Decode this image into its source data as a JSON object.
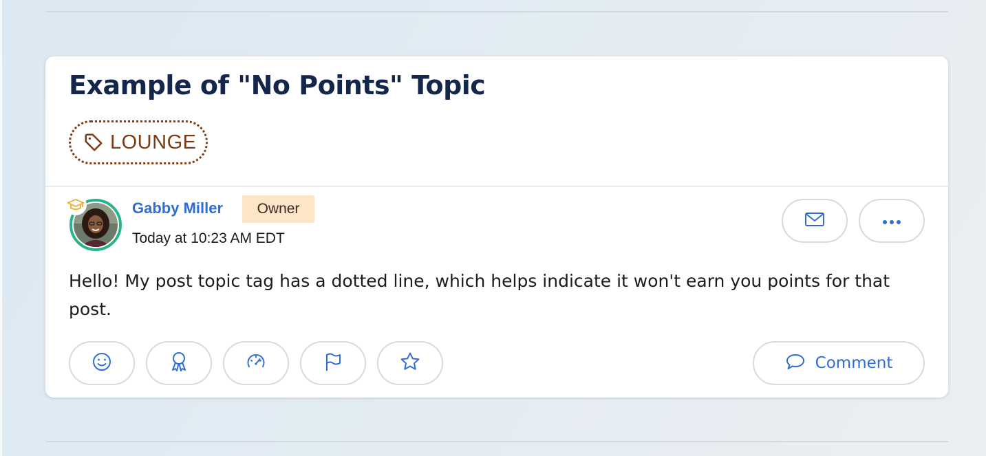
{
  "topic": {
    "title": "Example of \"No Points\" Topic",
    "tag": {
      "label": "LOUNGE",
      "style": "dotted"
    }
  },
  "post": {
    "author": {
      "name": "Gabby Miller",
      "role": "Owner",
      "badge_icon": "graduation-cap-icon"
    },
    "timestamp": "Today at 10:23 AM EDT",
    "body": "Hello! My post topic tag has a dotted line, which helps indicate it won't earn you points for that post."
  },
  "actions": {
    "header_icons": [
      "envelope-icon",
      "ellipsis-icon"
    ],
    "reaction_icons": [
      "smiley-icon",
      "award-ribbon-icon",
      "speedometer-icon",
      "flag-icon",
      "star-icon"
    ],
    "comment_label": "Comment"
  },
  "colors": {
    "title": "#14264a",
    "accent_blue": "#2f6dd6",
    "tag_brown": "#7a3c15",
    "avatar_ring": "#29b38b",
    "role_badge_bg": "#fde6c8",
    "grad_cap": "#f0b23a"
  }
}
